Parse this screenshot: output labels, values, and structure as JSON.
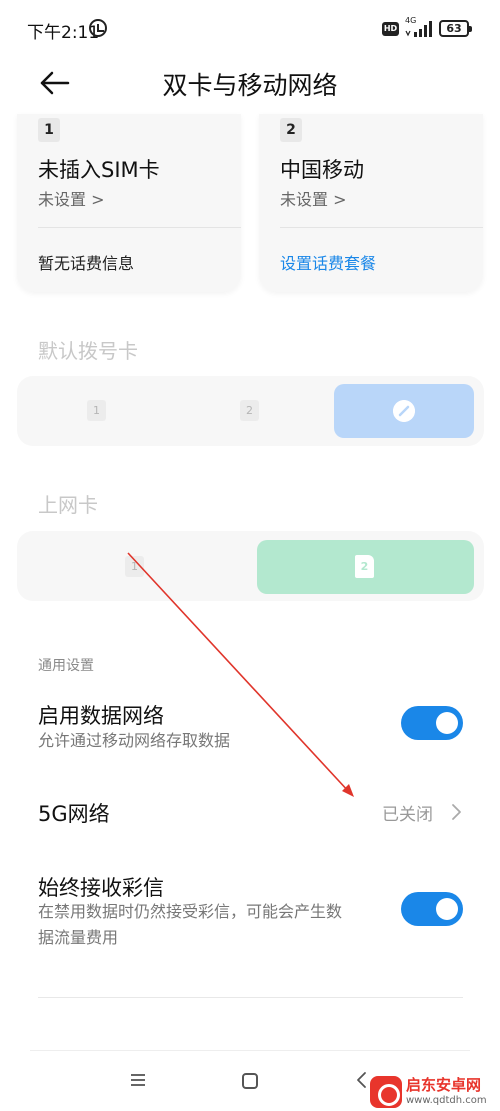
{
  "status_bar": {
    "time": "下午2:11",
    "hd": "HD",
    "network": "4G",
    "battery": "63"
  },
  "header": {
    "title": "双卡与移动网络"
  },
  "sim_cards": [
    {
      "slot": "1",
      "name": "未插入SIM卡",
      "status": "未设置 >",
      "info": "暂无话费信息"
    },
    {
      "slot": "2",
      "name": "中国移动",
      "status": "未设置 >",
      "info": "设置话费套餐"
    }
  ],
  "default_dial": {
    "label": "默认拨号卡",
    "options": [
      "1",
      "2"
    ]
  },
  "data_card": {
    "label": "上网卡",
    "options": [
      "1",
      "2"
    ]
  },
  "general": {
    "label": "通用设置",
    "enable_data": {
      "title": "启用数据网络",
      "desc": "允许通过移动网络存取数据",
      "enabled": true
    },
    "network_5g": {
      "title": "5G网络",
      "value": "已关闭"
    },
    "mms": {
      "title": "始终接收彩信",
      "desc_line1": "在禁用数据时仍然接受彩信，可能会产生数",
      "desc_line2": "据流量费用",
      "enabled": true
    }
  },
  "watermark": {
    "name": "启东安卓网",
    "url": "www.qdtdh.com"
  },
  "colors": {
    "accent": "#1a87e8",
    "dial_selected": "#b9d6f9",
    "data_selected": "#b3e8cf",
    "annotation_arrow": "#e0352b"
  }
}
